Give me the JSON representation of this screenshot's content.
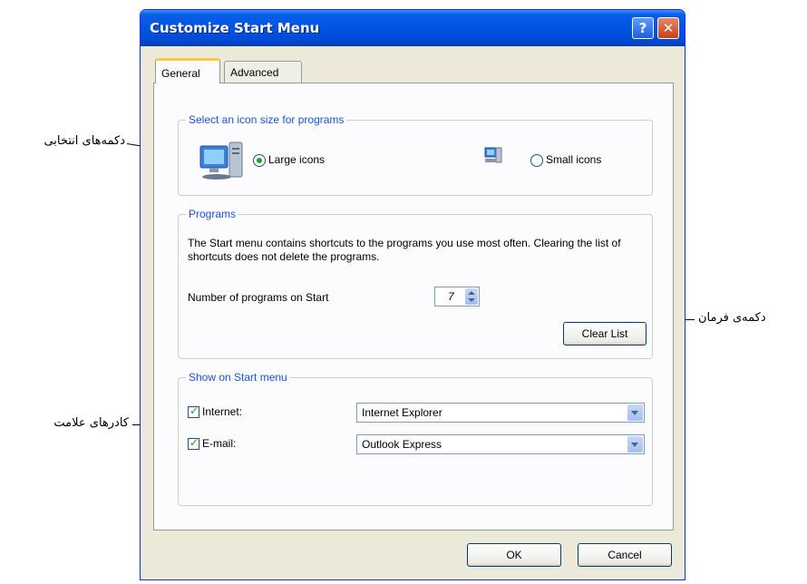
{
  "window": {
    "title": "Customize Start Menu",
    "help_button": "?",
    "close_button": "✕"
  },
  "tabs": [
    {
      "label": "General",
      "selected": true
    },
    {
      "label": "Advanced",
      "selected": false
    }
  ],
  "icon_size": {
    "legend": "Select an icon size for programs",
    "large_label": "Large icons",
    "small_label": "Small icons",
    "selected": "Large icons"
  },
  "programs": {
    "legend": "Programs",
    "description": "The Start menu contains shortcuts to the programs you use most often.  Clearing the list of shortcuts does not delete the programs.",
    "number_label": "Number of programs on Start",
    "number_value": "7",
    "clear_button": "Clear List"
  },
  "show_on_start": {
    "legend": "Show on Start menu",
    "internet_label": "Internet:",
    "internet_checked": true,
    "internet_value": "Internet Explorer",
    "email_label": "E-mail:",
    "email_checked": true,
    "email_value": "Outlook Express"
  },
  "footer": {
    "ok_label": "OK",
    "cancel_label": "Cancel"
  },
  "annotations": {
    "radio_buttons": "دکمه‌های انتخابی",
    "command_button": "دکمه‌ی فرمان",
    "checkboxes": "کادرهای علامت"
  },
  "colors": {
    "titlebar": "#0055e5",
    "legend_text": "#1a54d6",
    "dialog_bg": "#ece9d8",
    "tab_highlight": "#ffc83c"
  }
}
